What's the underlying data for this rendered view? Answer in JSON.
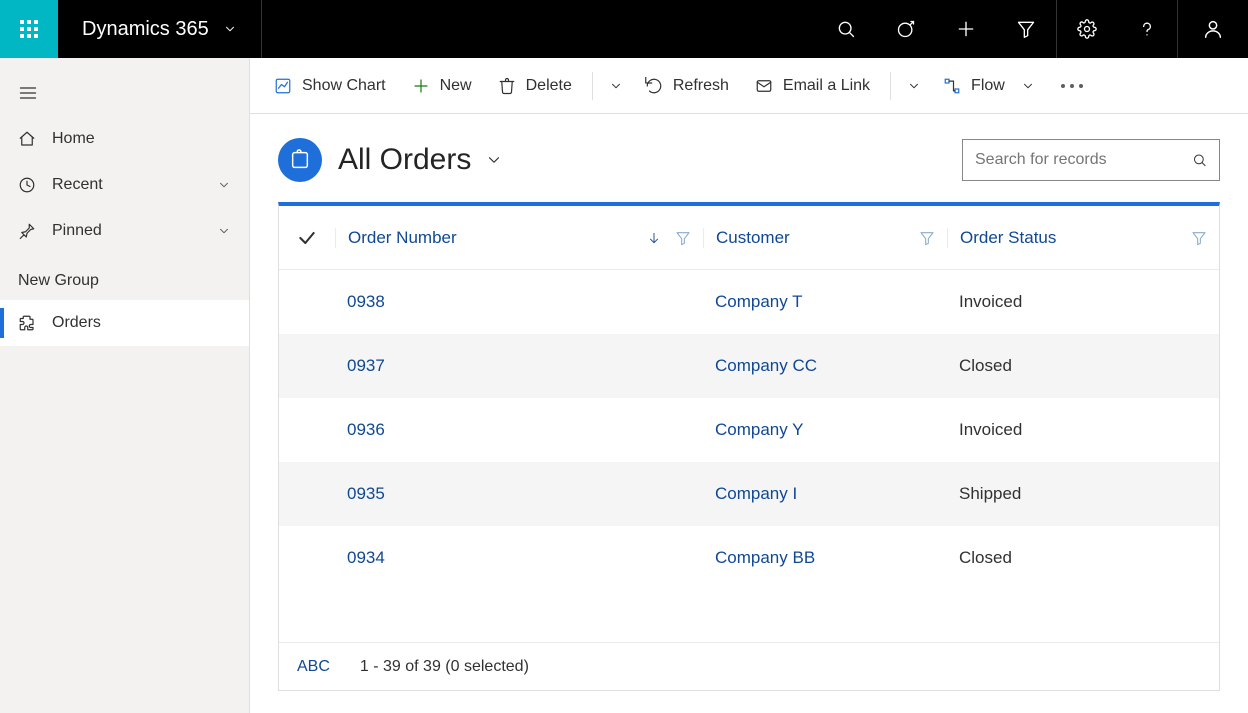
{
  "topbar": {
    "brand": "Dynamics 365"
  },
  "sidebar": {
    "home": "Home",
    "recent": "Recent",
    "pinned": "Pinned",
    "group_label": "New Group",
    "orders": "Orders"
  },
  "cmdbar": {
    "show_chart": "Show Chart",
    "new": "New",
    "delete": "Delete",
    "refresh": "Refresh",
    "email_link": "Email a Link",
    "flow": "Flow"
  },
  "view": {
    "title": "All Orders",
    "search_placeholder": "Search for records"
  },
  "grid": {
    "columns": {
      "order_number": "Order Number",
      "customer": "Customer",
      "order_status": "Order Status"
    },
    "rows": [
      {
        "order": "0938",
        "customer": "Company T",
        "status": "Invoiced"
      },
      {
        "order": "0937",
        "customer": "Company CC",
        "status": "Closed"
      },
      {
        "order": "0936",
        "customer": "Company Y",
        "status": "Invoiced"
      },
      {
        "order": "0935",
        "customer": "Company I",
        "status": "Shipped"
      },
      {
        "order": "0934",
        "customer": "Company BB",
        "status": "Closed"
      }
    ],
    "footer": {
      "abc": "ABC",
      "paging": "1 - 39 of 39 (0 selected)"
    }
  }
}
